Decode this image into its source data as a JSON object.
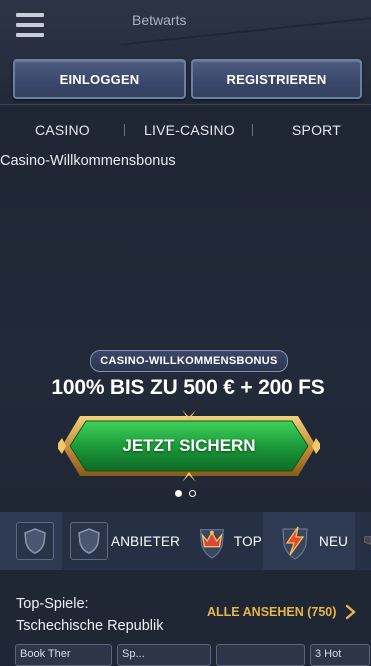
{
  "header": {
    "title": "Betwarts",
    "login_label": "EINLOGGEN",
    "register_label": "REGISTRIEREN"
  },
  "nav": {
    "items": [
      {
        "label": "CASINO"
      },
      {
        "label": "LIVE-CASINO"
      },
      {
        "label": "SPORT"
      }
    ]
  },
  "promo": {
    "heading": "Casino-Willkommensbonus",
    "badge": "CASINO-WILLKOMMENSBONUS",
    "headline": "100% BIS ZU 500 € + 200 FS",
    "cta_label": "JETZT SICHERN",
    "slides_total": 2,
    "slide_active": 1
  },
  "filters": {
    "items": [
      {
        "label": "",
        "icon": "shield-icon"
      },
      {
        "label": "ANBIETER",
        "icon": "shield-icon"
      },
      {
        "label": "TOP",
        "icon": "crown-icon"
      },
      {
        "label": "NEU",
        "icon": "lightning-icon"
      }
    ]
  },
  "section": {
    "title_line1": "Top-Spiele:",
    "title_line2": "Tschechische Republik",
    "see_all": "ALLE ANSEHEN (750)",
    "cards": [
      {
        "label": "Book Ther"
      },
      {
        "label": "Sp..."
      },
      {
        "label": ""
      },
      {
        "label": "3 Hot"
      }
    ]
  },
  "colors": {
    "background": "#1f2634",
    "accent_gold": "#e6b64a",
    "cta_green": "#1f9a3c",
    "button_blue": "#3a476a"
  }
}
